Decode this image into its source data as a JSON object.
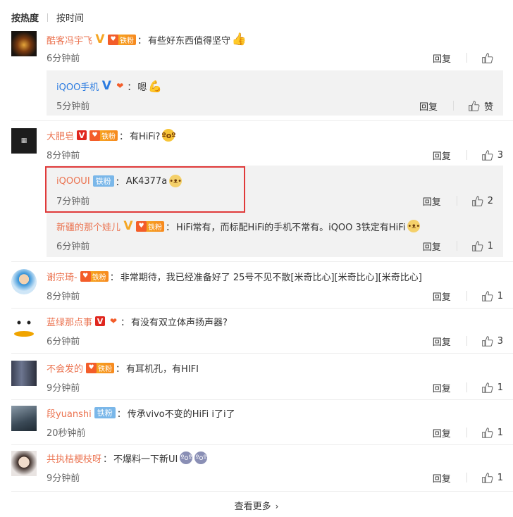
{
  "tabs": {
    "hot": "按热度",
    "time": "按时间"
  },
  "actions": {
    "reply": "回复",
    "like_word": "赞"
  },
  "comments": [
    {
      "name": "酷客冯宇飞",
      "content": "有些好东西值得坚守",
      "time": "6分钟前",
      "likes": ""
    },
    {
      "name": "iQOO手机",
      "content": "嗯",
      "time": "5分钟前",
      "likes": "赞"
    },
    {
      "name": "大肥皂",
      "content": "有HiFi?",
      "time": "8分钟前",
      "likes": "3"
    },
    {
      "name": "iQOOUI",
      "badge": "铁粉",
      "content": "AK4377a",
      "time": "7分钟前",
      "likes": "2"
    },
    {
      "name": "新疆的那个娃儿",
      "content": "HiFi常有，而标配HiFi的手机不常有。iQOO 3铁定有HiFi",
      "time": "6分钟前",
      "likes": "1"
    },
    {
      "name": "谢宗琦-",
      "content": "非常期待，我已经准备好了 25号不见不散[米奇比心][米奇比心][米奇比心]",
      "time": "8分钟前",
      "likes": "1"
    },
    {
      "name": "蓝绿那点事",
      "content": "有没有双立体声扬声器?",
      "time": "6分钟前",
      "likes": "3"
    },
    {
      "name": "不会发的",
      "content": "有耳机孔，有HIFI",
      "time": "9分钟前",
      "likes": "1"
    },
    {
      "name": "段yuanshi",
      "badge": "铁粉",
      "content": "传承vivo不变的HiFi i了i了",
      "time": "20秒钟前",
      "likes": "1"
    },
    {
      "name": "共执桔梗枝呀",
      "content": "不爆料一下新UI",
      "time": "9分钟前",
      "likes": "1"
    }
  ],
  "more": "查看更多",
  "colors": {
    "username": "#eb7350",
    "username_blue": "#2b7be0",
    "highlight": "#e03a3a",
    "sub_bg": "#f2f2f2"
  }
}
